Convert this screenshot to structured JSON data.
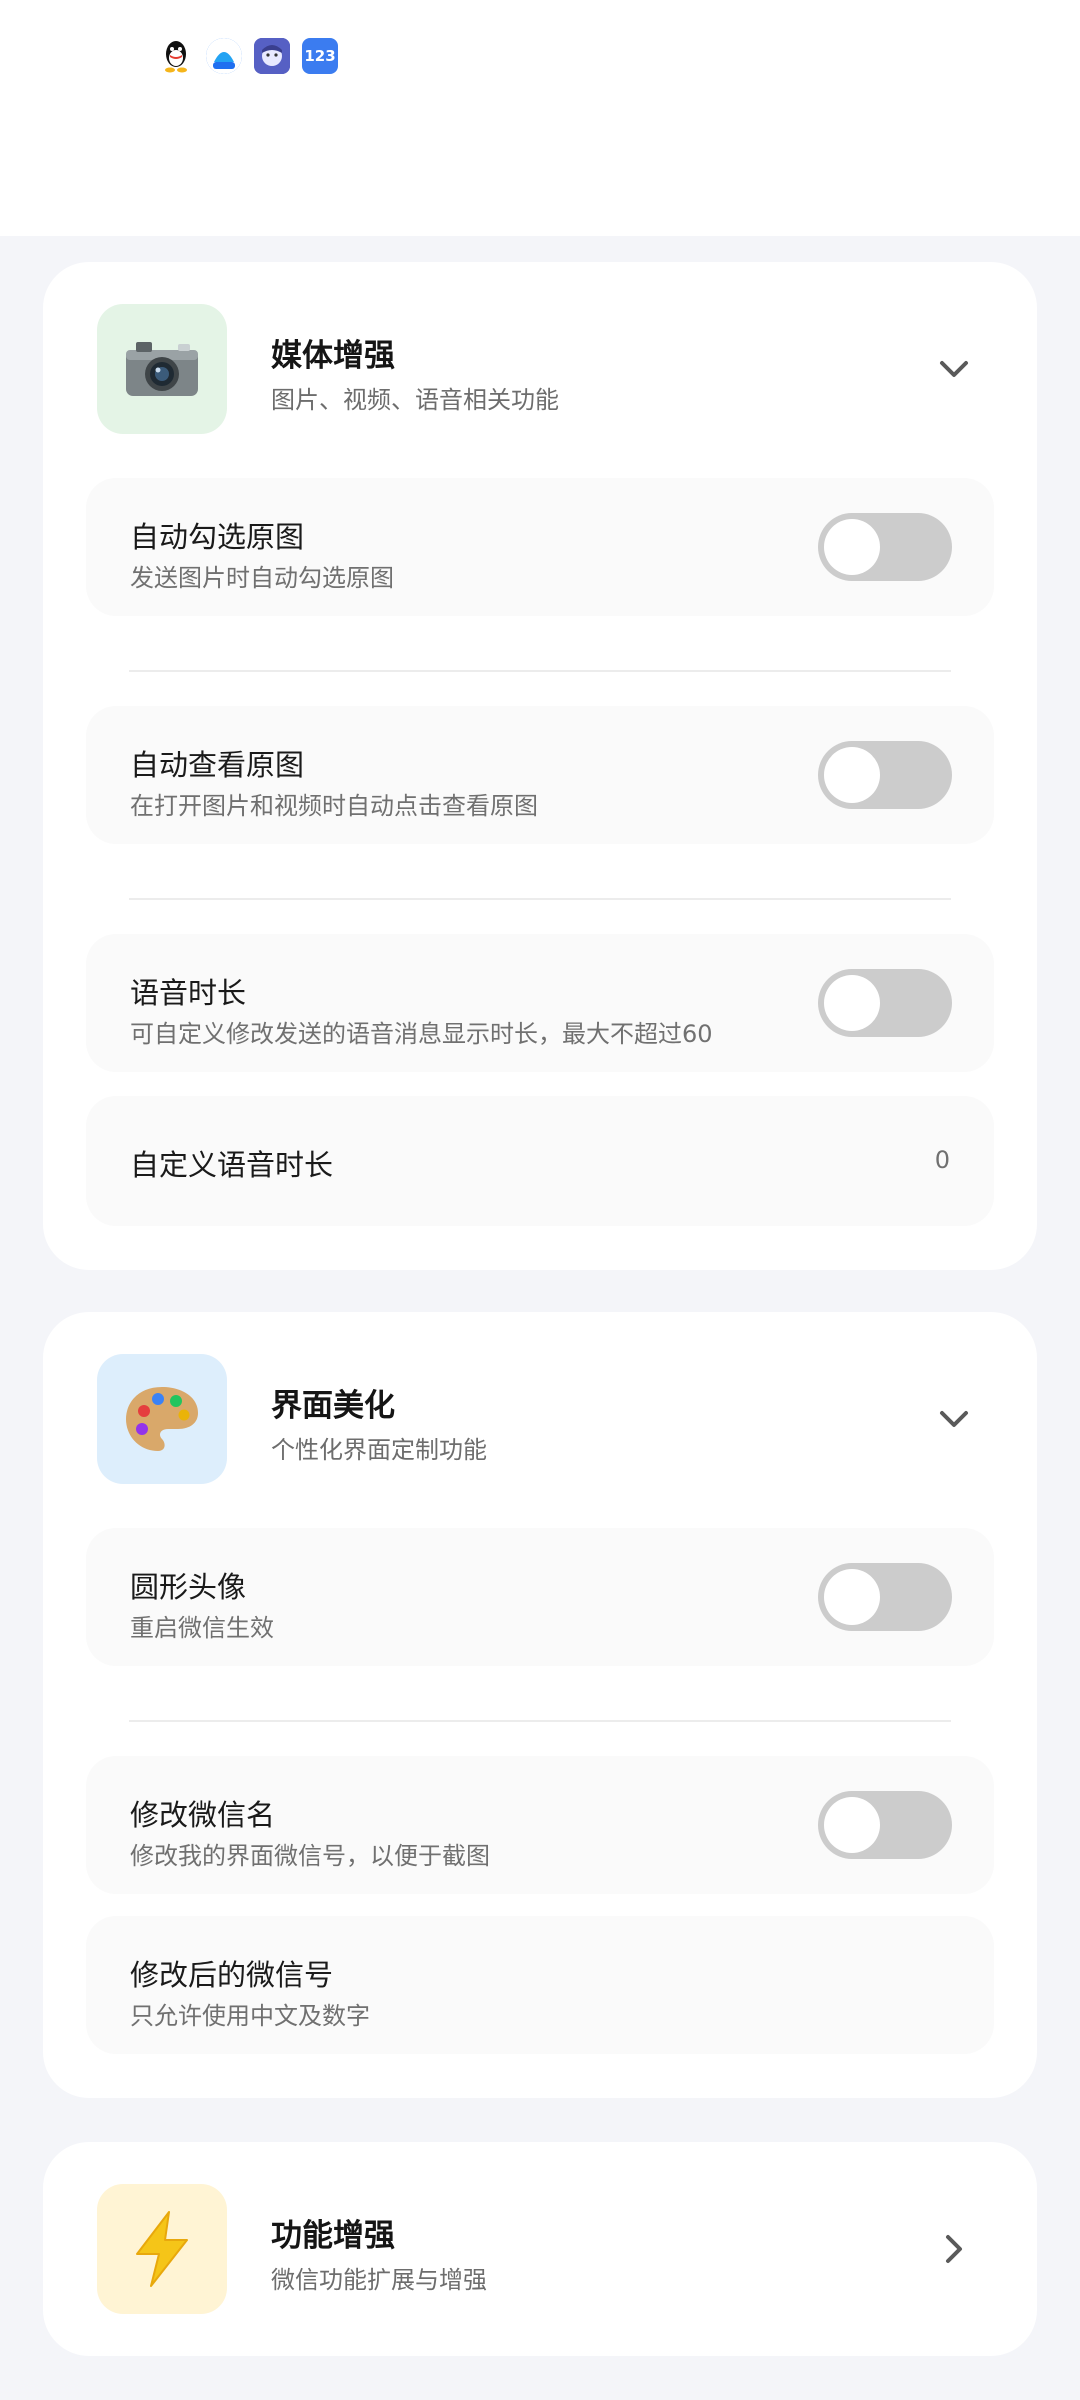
{
  "status_bar": {
    "icons": [
      "qq-icon",
      "baidu-netdisk-icon",
      "avatar-app-icon",
      "numbers-app-icon"
    ],
    "num_icon_text": "123"
  },
  "sections": [
    {
      "title": "媒体增强",
      "subtitle": "图片、视频、语音相关功能",
      "icon": "camera-icon",
      "icon_bg": "#e4f4e6",
      "expanded": true,
      "items": [
        {
          "title": "自动勾选原图",
          "desc": "发送图片时自动勾选原图",
          "type": "toggle",
          "on": false
        },
        {
          "title": "自动查看原图",
          "desc": "在打开图片和视频时自动点击查看原图",
          "type": "toggle",
          "on": false
        },
        {
          "title": "语音时长",
          "desc": "可自定义修改发送的语音消息显示时长，最大不超过60",
          "type": "toggle",
          "on": false
        },
        {
          "title": "自定义语音时长",
          "type": "value",
          "value": "0"
        }
      ]
    },
    {
      "title": "界面美化",
      "subtitle": "个性化界面定制功能",
      "icon": "palette-icon",
      "icon_bg": "#ddeefc",
      "expanded": true,
      "items": [
        {
          "title": "圆形头像",
          "desc": "重启微信生效",
          "type": "toggle",
          "on": false
        },
        {
          "title": "修改微信名",
          "desc": "修改我的界面微信号，以便于截图",
          "type": "toggle",
          "on": false
        },
        {
          "title": "修改后的微信号",
          "desc": "只允许使用中文及数字",
          "type": "input"
        }
      ]
    },
    {
      "title": "功能增强",
      "subtitle": "微信功能扩展与增强",
      "icon": "lightning-icon",
      "icon_bg": "#fff4d4",
      "expanded": false
    }
  ],
  "colors": {
    "background": "#f4f5f9",
    "card": "#ffffff",
    "row": "#fafafa",
    "toggle_off": "#cccccc",
    "chevron": "#5a5a5a"
  }
}
